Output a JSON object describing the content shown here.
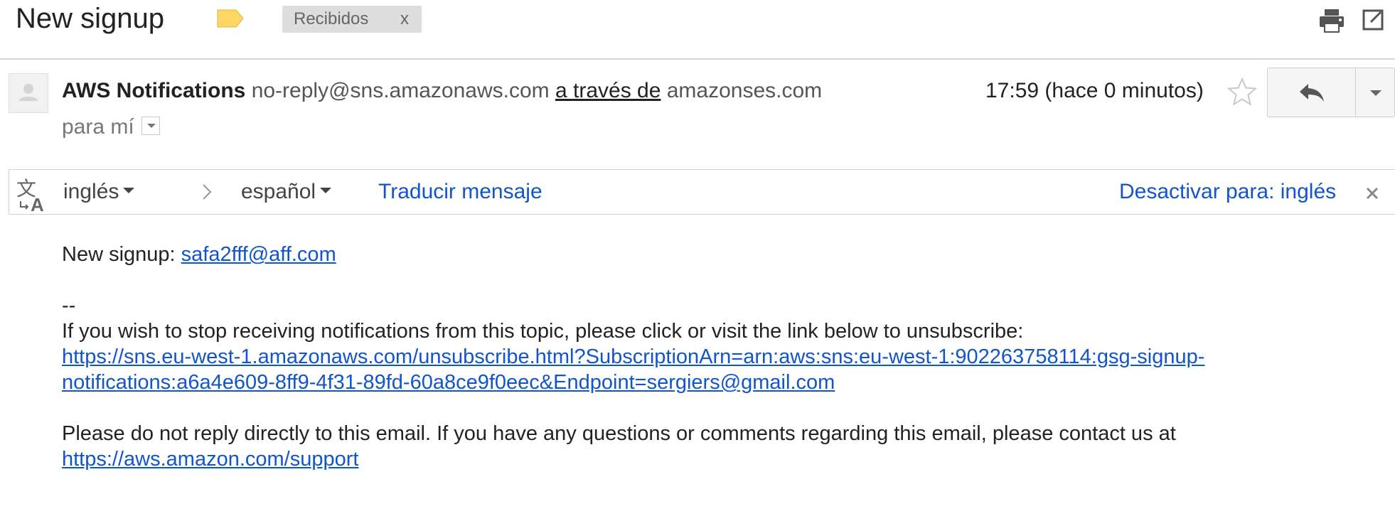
{
  "subject": {
    "title": "New signup",
    "label_chip": "Recibidos",
    "label_chip_close": "x"
  },
  "sender": {
    "name": "AWS Notifications",
    "email": "no-reply@sns.amazonaws.com",
    "via_text": "a través de",
    "via_domain": "amazonses.com",
    "recipient": "para mí",
    "timestamp": "17:59 (hace 0 minutos)"
  },
  "translate": {
    "from_language": "inglés",
    "to_language": "español",
    "translate_action": "Traducir mensaje",
    "disable_action": "Desactivar para: inglés"
  },
  "body": {
    "signup_prefix": "New signup: ",
    "signup_email": "safa2fff@aff.com",
    "separator": "--",
    "stop_text": "If you wish to stop receiving notifications from this topic, please click or visit the link below to unsubscribe:",
    "unsubscribe_line1": "https://sns.eu-west-1.amazonaws.com/unsubscribe.html?SubscriptionArn=arn:aws:sns:eu-west-1:902263758114:gsg-signup-",
    "unsubscribe_line2": "notifications:a6a4e609-8ff9-4f31-89fd-60a8ce9f0eec&Endpoint=sergiers@gmail.com",
    "contact_text": "Please do not reply directly to this email. If you have any questions or comments regarding this email, please contact us at",
    "support_link": "https://aws.amazon.com/support"
  },
  "icons": {
    "label": "label-tag-icon",
    "print": "print-icon",
    "new_window": "open-in-new-window-icon",
    "avatar": "person-avatar-icon",
    "star": "star-icon",
    "reply": "reply-icon",
    "more": "chevron-down-icon",
    "translate": "translate-icon",
    "arrow": "chevron-right-icon",
    "close": "close-icon"
  },
  "colors": {
    "link": "#1155cc",
    "label_tag": "#fdd663",
    "chip_background": "#dddddd"
  }
}
